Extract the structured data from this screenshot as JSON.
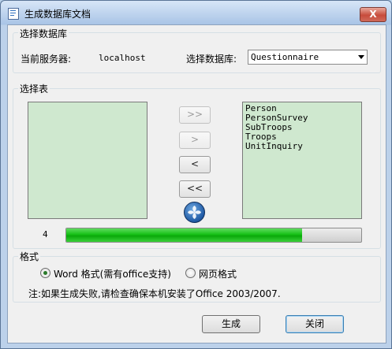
{
  "window": {
    "title": "生成数据库文档",
    "close_label": "X"
  },
  "database_group": {
    "label": "选择数据库",
    "server_label": "当前服务器:",
    "server_value": "localhost",
    "db_label": "选择数据库:",
    "db_selected": "Questionnaire"
  },
  "table_group": {
    "label": "选择表",
    "available_tables": [],
    "selected_tables": [
      "Person",
      "PersonSurvey",
      "SubTroops",
      "Troops",
      "UnitInquiry"
    ],
    "buttons": {
      "add_all": ">>",
      "add_one": ">",
      "remove_one": "<",
      "remove_all": "<<"
    },
    "progress_count": "4",
    "progress_value": 0.8,
    "logo_icon": "spinner-logo-icon"
  },
  "format_group": {
    "label": "格式",
    "options": [
      {
        "label": "Word 格式(需有office支持)",
        "checked": true
      },
      {
        "label": "网页格式",
        "checked": false
      }
    ],
    "note": "注:如果生成失败,请检查确保本机安装了Office 2003/2007."
  },
  "footer": {
    "generate_label": "生成",
    "close_label": "关闭"
  },
  "colors": {
    "listbox_bg": "#cfe8cf",
    "progress_fill": "#16c016"
  }
}
